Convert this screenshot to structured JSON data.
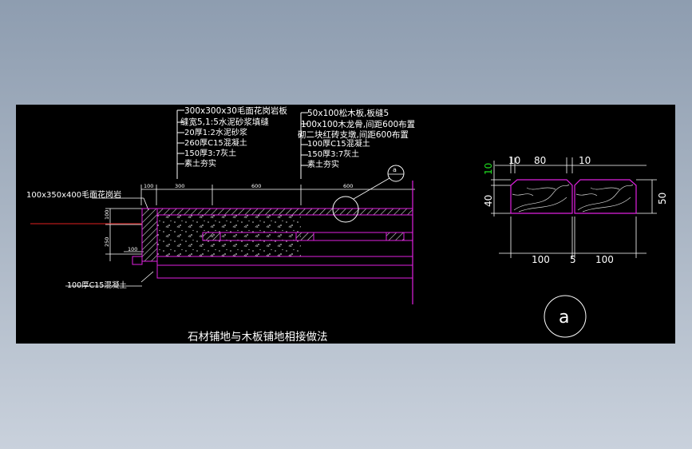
{
  "colors": {
    "background": "#000000",
    "outline": "#e020e0",
    "leader": "#ffffff",
    "dimension": "#ffffff",
    "highlight_dimension": "#20e020",
    "cut_line": "#e02020"
  },
  "section": {
    "title": "石材铺地与木板铺地相接做法",
    "left_layers": [
      "300x300x30毛面花岗岩板",
      "缝宽5,1:5水泥砂浆填缝",
      "20厚1:2水泥砂浆",
      "260厚C15混凝土",
      "150厚3:7灰土",
      "素土夯实"
    ],
    "right_layers": [
      "50x100松木板,板缝5",
      "100x100木龙骨,间距600布置",
      "砌二块红砖支墩,间距600布置",
      "100厚C15混凝土",
      "150厚3:7灰土",
      "素土夯实"
    ],
    "curb_label": "100x350x400毛面花岗岩",
    "footing_label": "100厚C15混凝土",
    "dims_top": [
      "100",
      "300",
      "600",
      "600"
    ],
    "dims_left": [
      "100",
      "250",
      "100"
    ],
    "detail_ref": "a"
  },
  "detail": {
    "dims_top": [
      "10",
      "80",
      "10"
    ],
    "dims_bottom": [
      "100",
      "5",
      "100"
    ],
    "dims_left": [
      "10",
      "40"
    ],
    "dims_right": [
      "50"
    ],
    "label": "a"
  }
}
